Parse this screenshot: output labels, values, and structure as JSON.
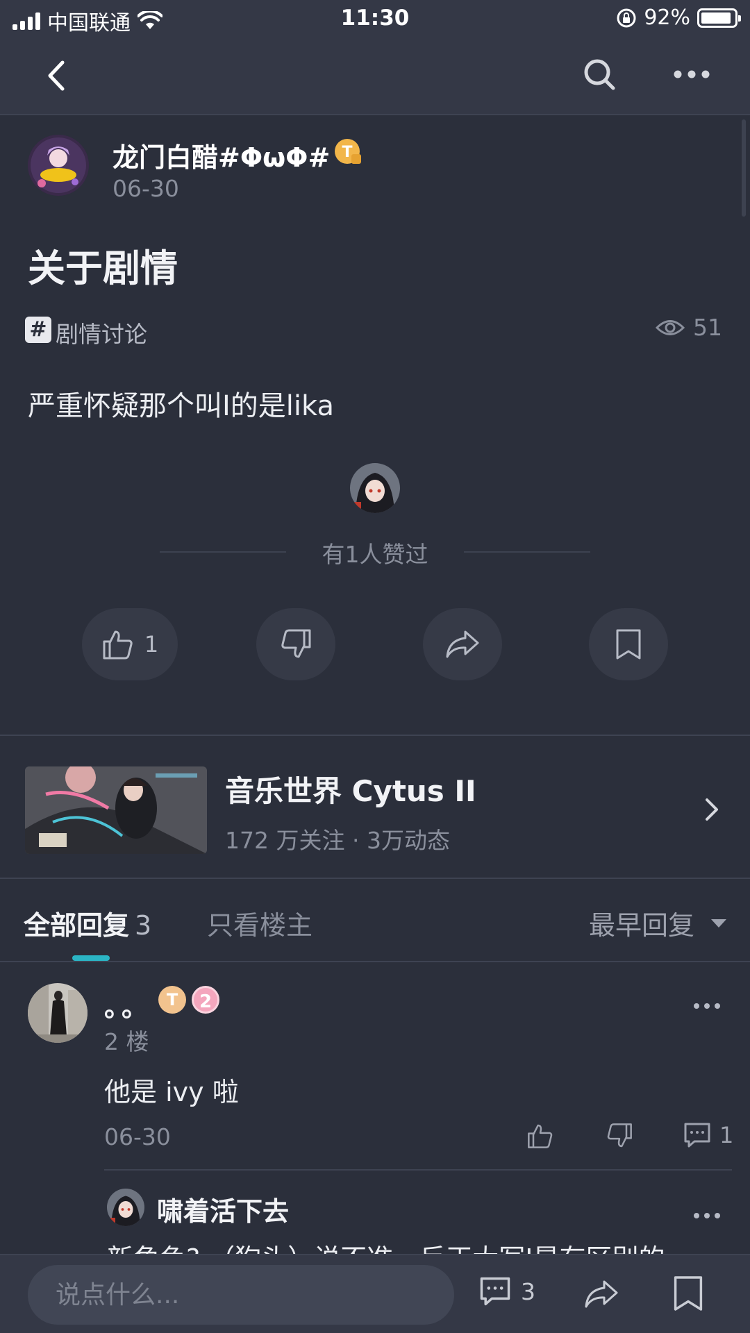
{
  "status_bar": {
    "carrier": "中国联通",
    "time": "11:30",
    "battery": "92%",
    "battery_level": 0.92
  },
  "nav": {
    "icons": [
      "back-icon",
      "search-icon",
      "more-icon"
    ]
  },
  "post": {
    "author": "龙门白醋#ΦωΦ#",
    "badge": "T",
    "date": "06-30",
    "title": "关于剧情",
    "tag": "剧情讨论",
    "tag_icon": "#",
    "views": "51",
    "body": "严重怀疑那个叫I的是lika",
    "liked_by": "有1人赞过",
    "like_count": "1"
  },
  "game": {
    "name": "音乐世界 Cytus II",
    "stats": "172 万关注 · 3万动态"
  },
  "tabs": {
    "all_label": "全部回复",
    "all_count": "3",
    "op_only": "只看楼主",
    "sort": "最早回复"
  },
  "reply": {
    "name": "。。",
    "badge_t": "T",
    "level": "2",
    "floor": "2 楼",
    "text": "他是 ivy 啦",
    "date": "06-30",
    "comment_count": "1",
    "sub_reply": {
      "name": "啸着活下去",
      "text": "新角色? （狗头）说不准，反正大写I是有区别的"
    }
  },
  "bottom_bar": {
    "placeholder": "说点什么...",
    "comment_count": "3"
  },
  "colors": {
    "background": "#2b2f3b",
    "bar": "#343846",
    "accent": "#2bb5c5"
  }
}
